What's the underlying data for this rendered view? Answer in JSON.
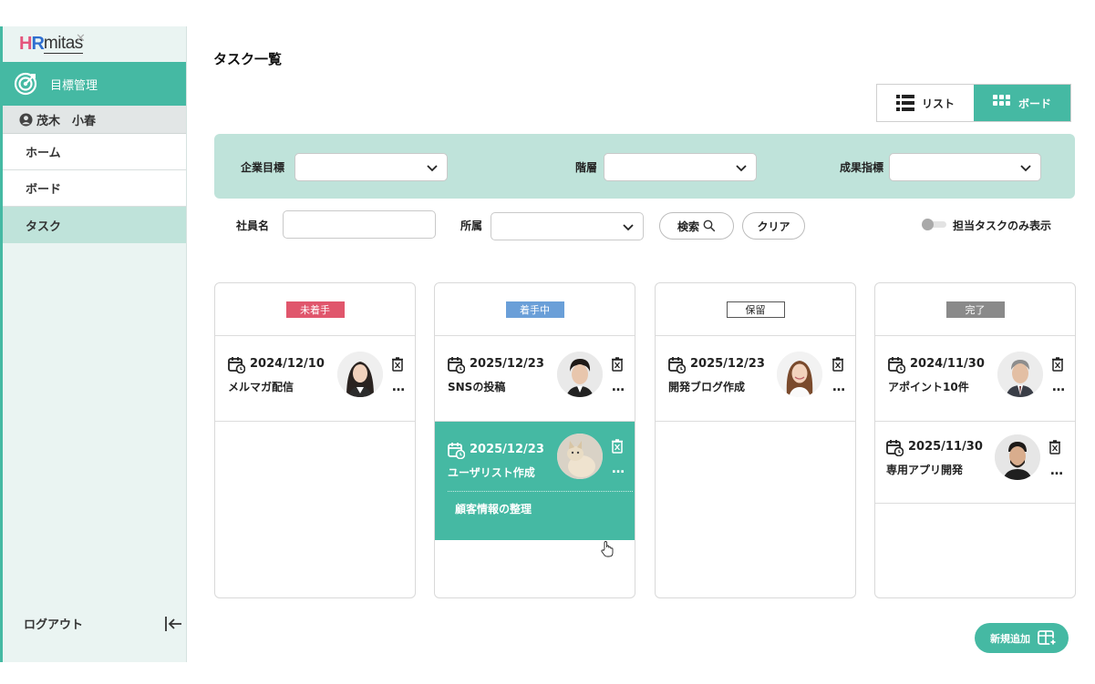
{
  "brand": {
    "logo_hr": "HR",
    "logo_mitas": "mitas"
  },
  "sidebar": {
    "main_label": "目標管理",
    "user_name": "茂木　小春",
    "items": [
      {
        "label": "ホーム",
        "active": false
      },
      {
        "label": "ボード",
        "active": false
      },
      {
        "label": "タスク",
        "active": true
      }
    ],
    "logout_label": "ログアウト"
  },
  "header": {
    "title": "タスク一覧",
    "view_toggle": {
      "list_label": "リスト",
      "board_label": "ボード",
      "selected": "ボード"
    }
  },
  "filters": {
    "company_goal_label": "企業目標",
    "hierarchy_label": "階層",
    "kpi_label": "成果指標",
    "employee_label": "社員名",
    "department_label": "所属",
    "search_label": "検索",
    "clear_label": "クリア",
    "mine_only_label": "担当タスクのみ表示",
    "mine_only_enabled": false
  },
  "board": {
    "columns": [
      {
        "status": "未着手",
        "badge_color": "#e0566c",
        "cards": [
          {
            "date": "2024/12/10",
            "title": "メルマガ配信",
            "avatar": "woman-dark-hair"
          }
        ]
      },
      {
        "status": "着手中",
        "badge_color": "#6a9fd8",
        "cards": [
          {
            "date": "2025/12/23",
            "title": "SNSの投稿",
            "avatar": "man-short-hair"
          },
          {
            "date": "2025/12/23",
            "title": "ユーザリスト作成",
            "avatar": "cat",
            "highlighted": true,
            "subtask": "顧客情報の整理"
          }
        ]
      },
      {
        "status": "保留",
        "badge_color": "#ffffff",
        "cards": [
          {
            "date": "2025/12/23",
            "title": "開発ブログ作成",
            "avatar": "woman-smiling"
          }
        ]
      },
      {
        "status": "完了",
        "badge_color": "#8a8a8a",
        "cards": [
          {
            "date": "2024/11/30",
            "title": "アポイント10件",
            "avatar": "man-gray-hair"
          },
          {
            "date": "2025/11/30",
            "title": "専用アプリ開発",
            "avatar": "man-beard"
          }
        ]
      }
    ]
  },
  "add_button_label": "新規追加",
  "colors": {
    "accent": "#45b9a3",
    "filter_band": "#bfe3da",
    "sidebar_bg": "#eaf4f2"
  }
}
